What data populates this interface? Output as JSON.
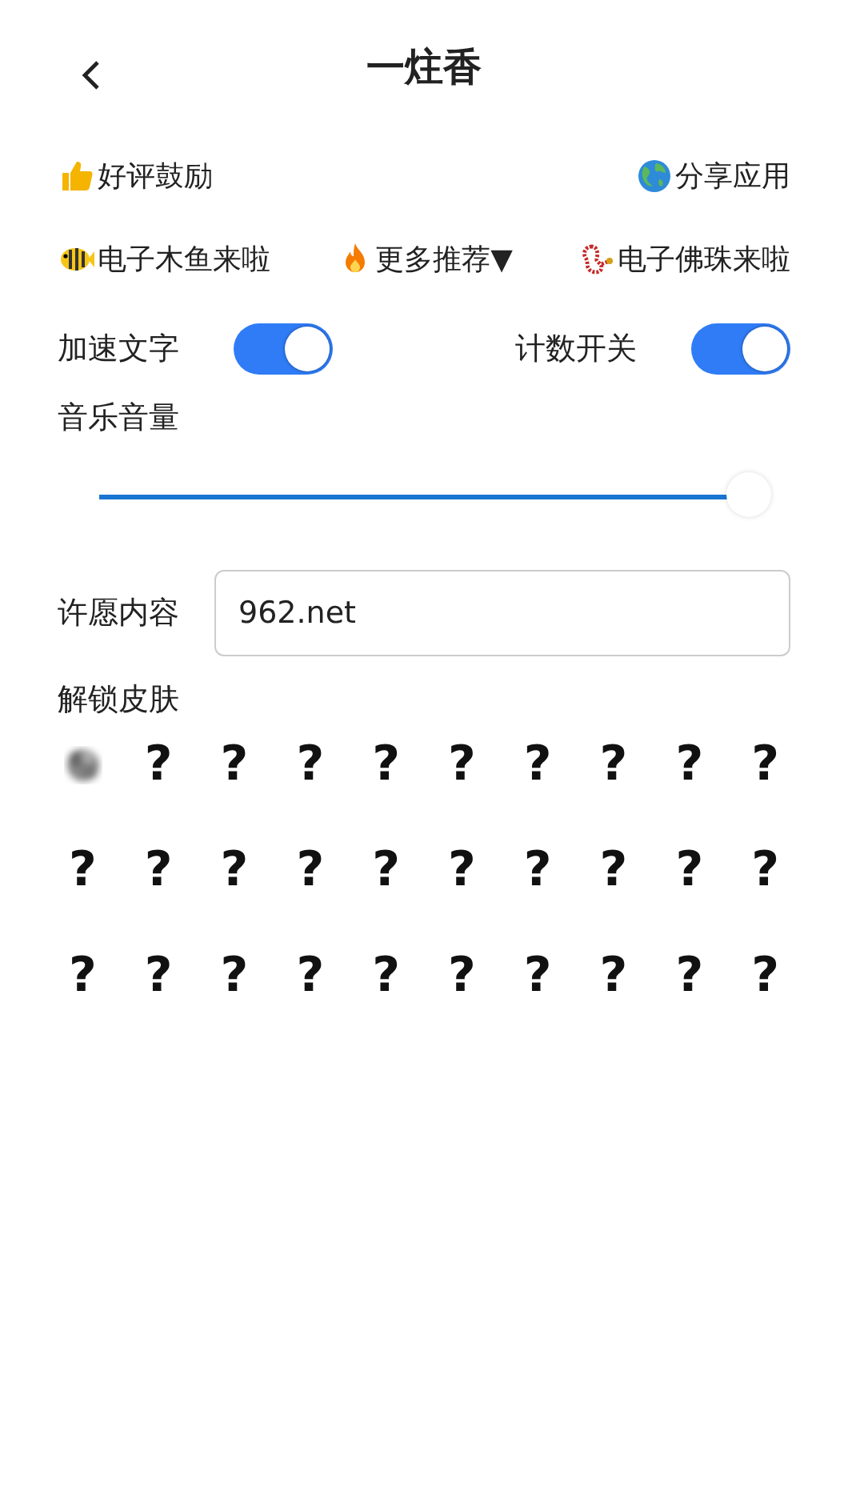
{
  "header": {
    "title": "一炷香"
  },
  "links_row_1": [
    {
      "kind": "thumb",
      "label": "好评鼓励"
    },
    {
      "kind": "globe",
      "label": "分享应用"
    }
  ],
  "links_row_2": [
    {
      "kind": "fish",
      "label": "电子木鱼来啦"
    },
    {
      "kind": "fire",
      "label": "更多推荐▼"
    },
    {
      "kind": "beads",
      "label": "电子佛珠来啦"
    }
  ],
  "switches": [
    {
      "label": "加速文字",
      "on": true
    },
    {
      "label": "计数开关",
      "on": true
    }
  ],
  "volume": {
    "label": "音乐音量",
    "level": 1
  },
  "wish": {
    "label": "许愿内容",
    "value": "962.net"
  },
  "skins": {
    "title": "解锁皮肤",
    "items": [
      {
        "kind": "smoke"
      },
      {
        "kind": "locked",
        "label": "?"
      },
      {
        "kind": "locked",
        "label": "?"
      },
      {
        "kind": "locked",
        "label": "?"
      },
      {
        "kind": "locked",
        "label": "?"
      },
      {
        "kind": "locked",
        "label": "?"
      },
      {
        "kind": "locked",
        "label": "?"
      },
      {
        "kind": "locked",
        "label": "?"
      },
      {
        "kind": "locked",
        "label": "?"
      },
      {
        "kind": "locked",
        "label": "?"
      },
      {
        "kind": "locked",
        "label": "?"
      },
      {
        "kind": "locked",
        "label": "?"
      },
      {
        "kind": "locked",
        "label": "?"
      },
      {
        "kind": "locked",
        "label": "?"
      },
      {
        "kind": "locked",
        "label": "?"
      },
      {
        "kind": "locked",
        "label": "?"
      },
      {
        "kind": "locked",
        "label": "?"
      },
      {
        "kind": "locked",
        "label": "?"
      },
      {
        "kind": "locked",
        "label": "?"
      },
      {
        "kind": "locked",
        "label": "?"
      },
      {
        "kind": "locked",
        "label": "?"
      },
      {
        "kind": "locked",
        "label": "?"
      },
      {
        "kind": "locked",
        "label": "?"
      },
      {
        "kind": "locked",
        "label": "?"
      },
      {
        "kind": "locked",
        "label": "?"
      },
      {
        "kind": "locked",
        "label": "?"
      },
      {
        "kind": "locked",
        "label": "?"
      },
      {
        "kind": "locked",
        "label": "?"
      },
      {
        "kind": "locked",
        "label": "?"
      },
      {
        "kind": "locked",
        "label": "?"
      }
    ]
  }
}
